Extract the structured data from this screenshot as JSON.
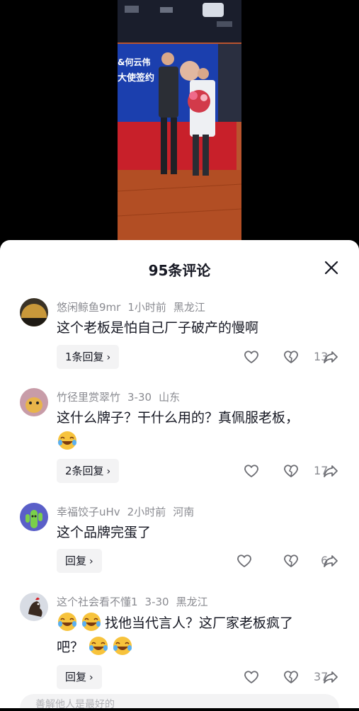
{
  "video": {
    "banner_text_top": "&何云伟",
    "banner_text_bottom": "大使签约"
  },
  "sheet": {
    "title": "95条评论"
  },
  "comments": [
    {
      "username": "悠闲鲸鱼9mr",
      "time": "1小时前",
      "location": "黑龙江",
      "text": "这个老板是怕自己厂子破产的慢啊",
      "reply_label": "1条回复",
      "likes": "13"
    },
    {
      "username": "竹径里赏翠竹",
      "time": "3-30",
      "location": "山东",
      "text": "这什么牌子？干什么用的？真佩服老板，",
      "reply_label": "2条回复",
      "likes": "17"
    },
    {
      "username": "幸福饺子uHv",
      "time": "2小时前",
      "location": "河南",
      "text": "这个品牌完蛋了",
      "reply_label": "回复",
      "likes": "6"
    },
    {
      "username": "这个社会看不懂1",
      "time": "3-30",
      "location": "黑龙江",
      "text_line1": "找他当代言人？这厂家老板疯了",
      "text_line2": "吧？",
      "reply_label": "回复",
      "likes": "37"
    }
  ],
  "input": {
    "placeholder": "善解他人是最好的"
  },
  "icons": {
    "close": "close-icon",
    "like": "heart-icon",
    "dislike": "broken-heart-icon",
    "share": "share-arrow-icon",
    "emoji": "laugh-cry-emoji"
  },
  "colors": {
    "text": "#161823",
    "meta": "#8a8b91",
    "reply_bg": "#f3f3f4"
  }
}
